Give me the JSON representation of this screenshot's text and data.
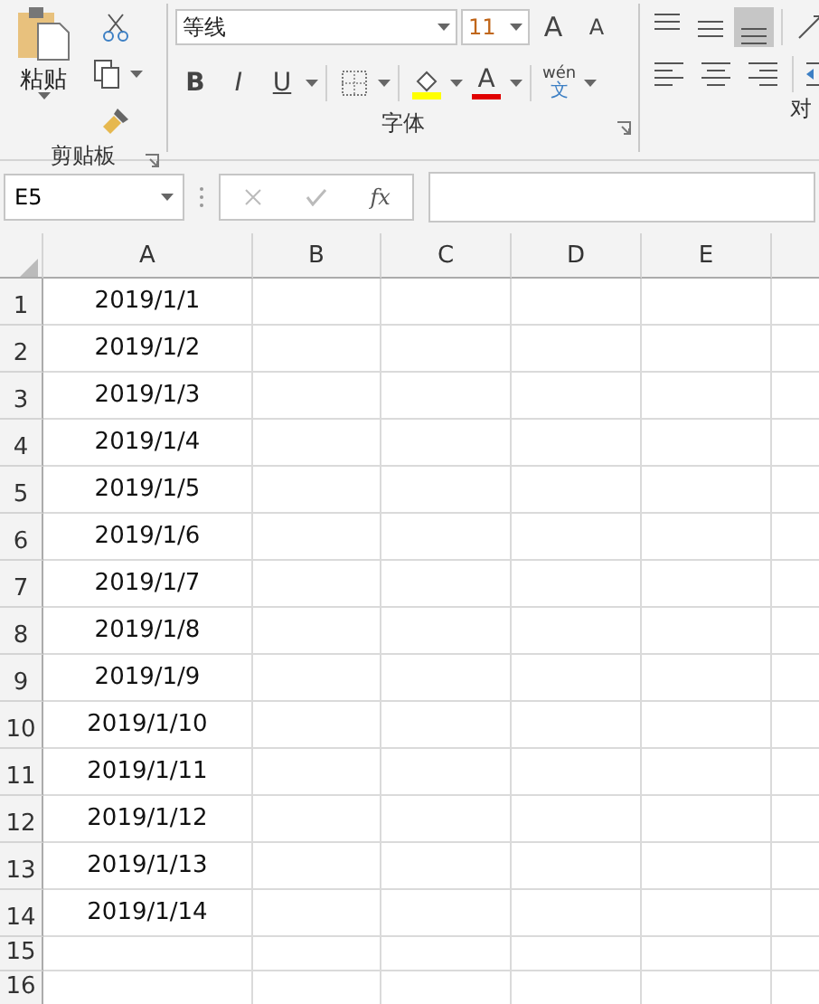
{
  "ribbon": {
    "clipboard": {
      "paste_label": "粘贴",
      "group_label": "剪贴板"
    },
    "font": {
      "font_name": "等线",
      "font_size": "11",
      "grow_label": "A",
      "shrink_label": "A",
      "bold_label": "B",
      "italic_label": "I",
      "underline_label": "U",
      "font_color_label": "A",
      "phonetic_top": "wén",
      "phonetic_bottom": "文",
      "group_label": "字体"
    },
    "alignment": {
      "vertical": [
        {
          "kind": "top",
          "selected": false
        },
        {
          "kind": "middle",
          "selected": false
        },
        {
          "kind": "bottom",
          "selected": true
        }
      ],
      "horizontal": [
        {
          "kind": "left",
          "selected": false
        },
        {
          "kind": "center",
          "selected": false
        },
        {
          "kind": "right",
          "selected": false
        }
      ],
      "group_label": "对"
    }
  },
  "formula_bar": {
    "name_box": "E5",
    "fx_label": "fx"
  },
  "sheet": {
    "columns": [
      "A",
      "B",
      "C",
      "D",
      "E"
    ],
    "rows": [
      {
        "number": "1",
        "kind": "tall",
        "a": "2019/1/1"
      },
      {
        "number": "2",
        "kind": "tall",
        "a": "2019/1/2"
      },
      {
        "number": "3",
        "kind": "tall",
        "a": "2019/1/3"
      },
      {
        "number": "4",
        "kind": "tall",
        "a": "2019/1/4"
      },
      {
        "number": "5",
        "kind": "tall",
        "a": "2019/1/5"
      },
      {
        "number": "6",
        "kind": "tall",
        "a": "2019/1/6"
      },
      {
        "number": "7",
        "kind": "tall",
        "a": "2019/1/7"
      },
      {
        "number": "8",
        "kind": "tall",
        "a": "2019/1/8"
      },
      {
        "number": "9",
        "kind": "tall",
        "a": "2019/1/9"
      },
      {
        "number": "10",
        "kind": "tall",
        "a": "2019/1/10"
      },
      {
        "number": "11",
        "kind": "tall",
        "a": "2019/1/11"
      },
      {
        "number": "12",
        "kind": "tall",
        "a": "2019/1/12"
      },
      {
        "number": "13",
        "kind": "tall",
        "a": "2019/1/13"
      },
      {
        "number": "14",
        "kind": "tall",
        "a": "2019/1/14"
      },
      {
        "number": "15",
        "kind": "short"
      },
      {
        "number": "16",
        "kind": "short"
      }
    ]
  }
}
